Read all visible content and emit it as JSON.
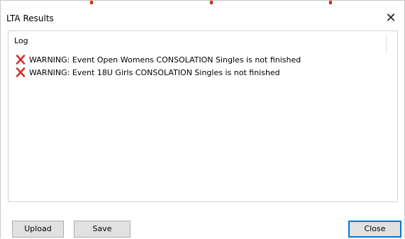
{
  "window": {
    "title": "LTA Results",
    "close_glyph": "✕"
  },
  "log": {
    "header": "Log",
    "entries": [
      {
        "icon": "red-x-icon",
        "text": "WARNING: Event Open Womens CONSOLATION Singles is not finished"
      },
      {
        "icon": "red-x-icon",
        "text": "WARNING: Event 18U Girls CONSOLATION Singles is not finished"
      }
    ]
  },
  "buttons": {
    "upload": "Upload",
    "save": "Save",
    "close": "Close"
  },
  "colors": {
    "warning_icon": "#d32f2f",
    "accent_border": "#0078d7",
    "top_marks": "#c0392b"
  }
}
